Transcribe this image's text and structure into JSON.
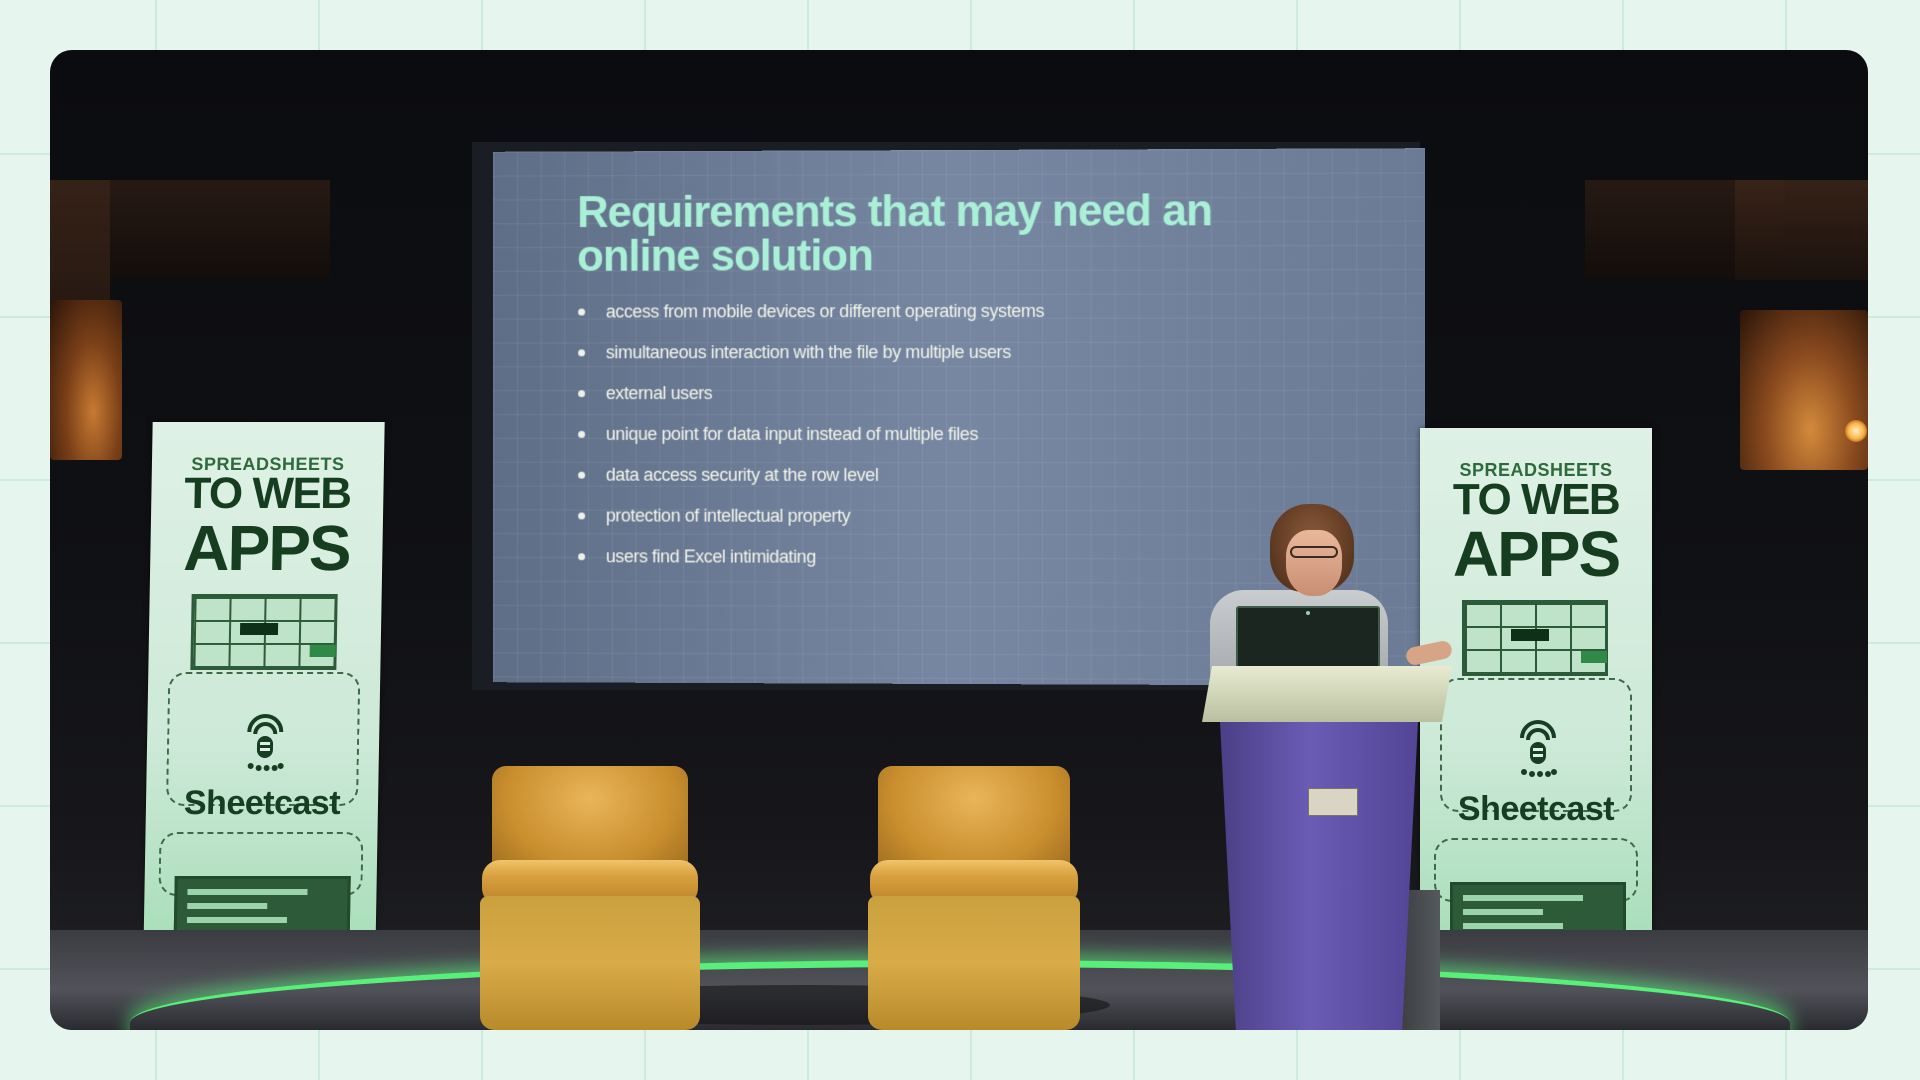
{
  "slide": {
    "title": "Requirements that may need an online solution",
    "bullets": [
      "access from mobile devices or different operating systems",
      "simultaneous interaction with the file by multiple users",
      "external users",
      "unique point for data input instead of multiple files",
      "data access security at the row level",
      "protection of intellectual property",
      "users find Excel intimidating"
    ]
  },
  "banner": {
    "line1": "SPREADSHEETS",
    "line2": "TO WEB",
    "line3": "APPS",
    "brand": "Sheetcast"
  },
  "colors": {
    "slide_title": "#a9f0d6",
    "slide_background": "#6f7f9a",
    "banner_green": "#163d20",
    "stage_glow": "#58f07a",
    "chair": "#d8a03e",
    "podium": "#5a4ca0",
    "page_background": "#e6f6ee"
  },
  "icons": {
    "banner_logo": "podcast-microphone-icon"
  }
}
